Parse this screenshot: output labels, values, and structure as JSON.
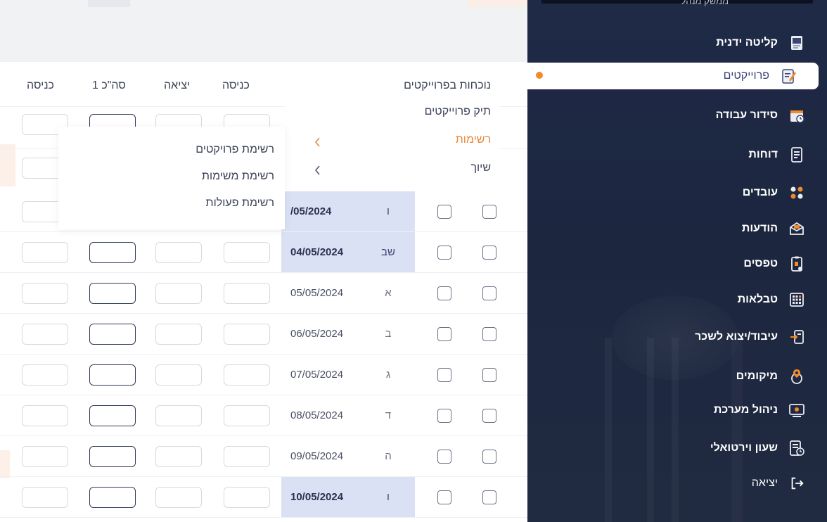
{
  "sidebar": {
    "header_text": "ממשק מנהל",
    "items": [
      {
        "label": "קליטה ידנית",
        "icon": "manual-entry-icon"
      },
      {
        "label": "פרוייקטים",
        "icon": "projects-icon",
        "active": true
      },
      {
        "label": "סידור עבודה",
        "icon": "calendar-icon"
      },
      {
        "label": "דוחות",
        "icon": "reports-icon"
      },
      {
        "label": "עובדים",
        "icon": "employees-icon"
      },
      {
        "label": "הודעות",
        "icon": "messages-icon"
      },
      {
        "label": "טפסים",
        "icon": "forms-icon"
      },
      {
        "label": "טבלאות",
        "icon": "tables-icon"
      },
      {
        "label": "עיבוד/יצוא לשכר",
        "icon": "payroll-export-icon"
      },
      {
        "label": "מיקומים",
        "icon": "locations-icon"
      },
      {
        "label": "ניהול מערכת",
        "icon": "system-admin-icon"
      },
      {
        "label": "שעון וירטואלי",
        "icon": "virtual-clock-icon"
      },
      {
        "label": "יציאה",
        "icon": "logout-icon"
      }
    ],
    "accent": "#f08a2e"
  },
  "projects_menu": {
    "items": [
      {
        "label": "נוכחות בפרוייקטים"
      },
      {
        "label": "תיק פרוייקטים"
      },
      {
        "label": "רשימות",
        "highlight": true,
        "chevron": "chevron-left-icon"
      },
      {
        "label": "שיוך",
        "chevron": "chevron-left-icon"
      }
    ],
    "submenu": [
      "רשימת פרויקטים",
      "רשימת משימות",
      "רשימת פעולות"
    ]
  },
  "table": {
    "columns": [
      "כניסה",
      "יציאה",
      "סה\"כ 1",
      "כניסה"
    ],
    "rows": [
      {
        "date": "/05/2024",
        "day": "ו",
        "highlight": true
      },
      {
        "date": "04/05/2024",
        "day": "שב",
        "highlight": true
      },
      {
        "date": "05/05/2024",
        "day": "א"
      },
      {
        "date": "06/05/2024",
        "day": "ב"
      },
      {
        "date": "07/05/2024",
        "day": "ג"
      },
      {
        "date": "08/05/2024",
        "day": "ד"
      },
      {
        "date": "09/05/2024",
        "day": "ה"
      },
      {
        "date": "10/05/2024",
        "day": "ו",
        "highlight": true
      }
    ]
  },
  "colors": {
    "sidebar_bg": "#1f2a47",
    "highlight_cell": "#dbe1f4",
    "orange": "#e8893a"
  }
}
